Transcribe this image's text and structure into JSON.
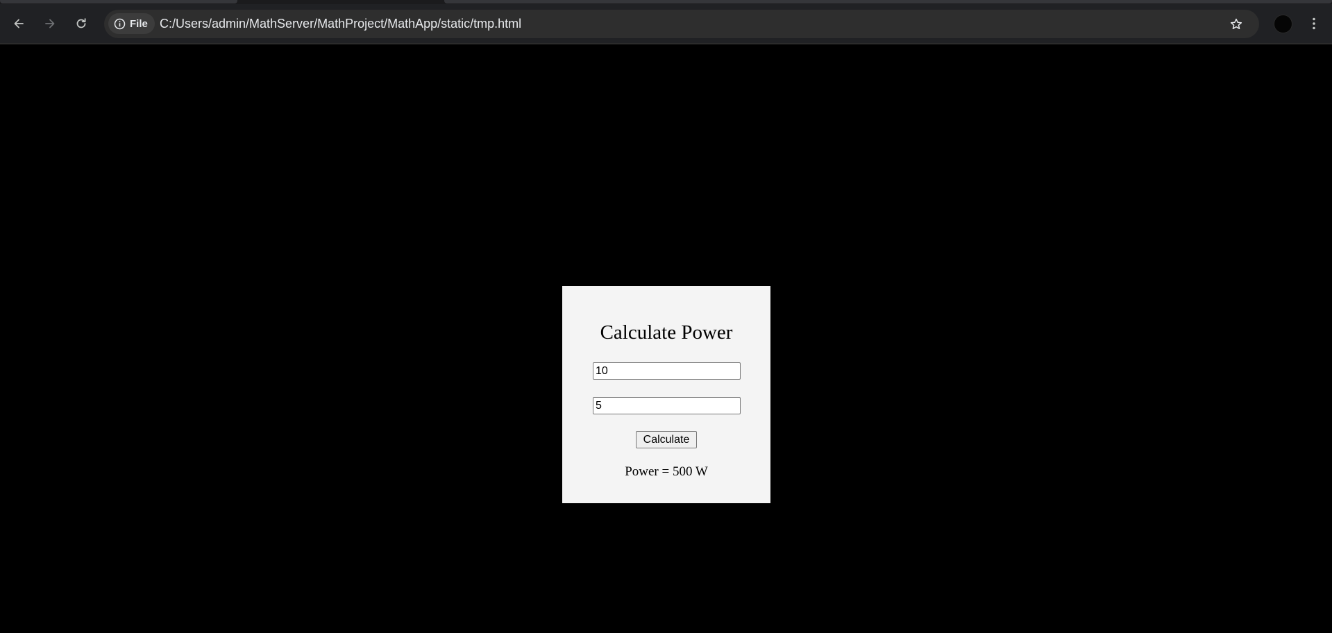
{
  "browser": {
    "site_chip_label": "File",
    "url": "C:/Users/admin/MathServer/MathProject/MathApp/static/tmp.html",
    "icons": {
      "back": "arrow-left-icon",
      "forward": "arrow-right-icon",
      "reload": "reload-icon",
      "site_info": "info-icon",
      "bookmark": "star-icon",
      "profile": "avatar",
      "menu": "kebab-menu-icon"
    },
    "colors": {
      "toolbar": "#202124",
      "omnibox": "#2e2e2e",
      "text": "#e8eaed"
    }
  },
  "page": {
    "background": "#000000",
    "card": {
      "background": "#f4f4f4",
      "title": "Calculate Power",
      "input_1_value": "10",
      "input_2_value": "5",
      "button_label": "Calculate",
      "result_text": "Power = 500 W"
    }
  }
}
